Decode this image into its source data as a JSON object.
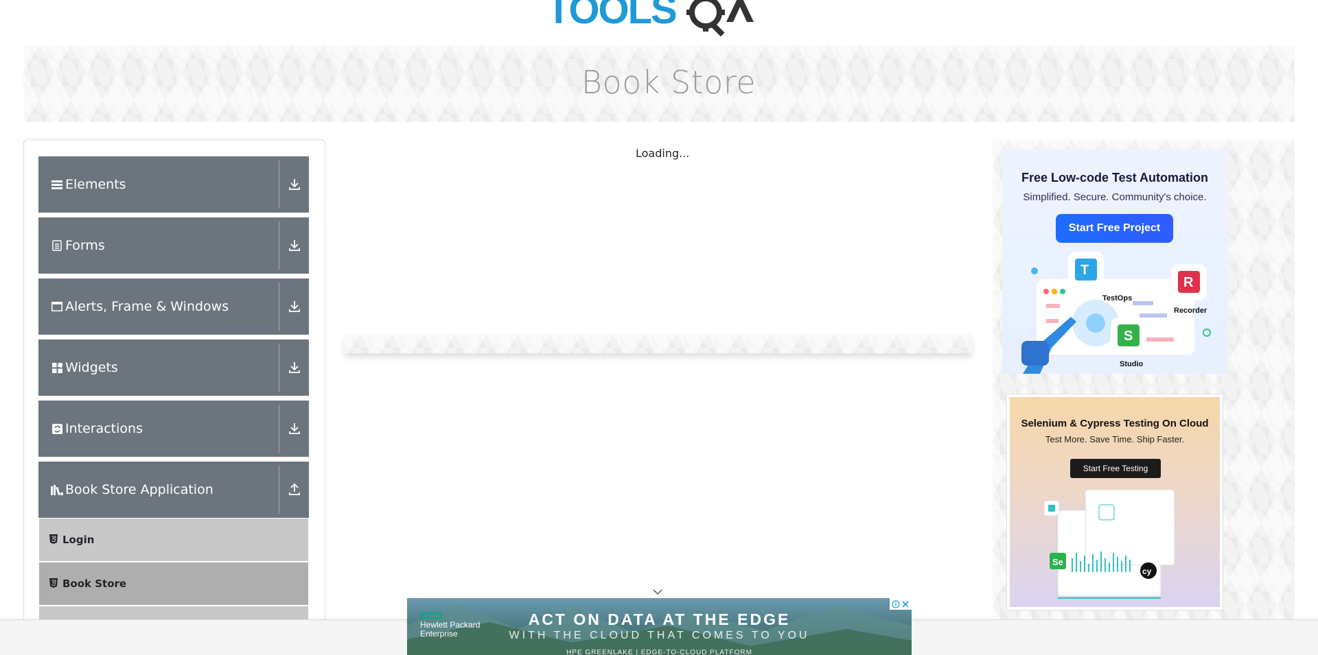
{
  "logo": {
    "text": "TOOLSQA",
    "colors": {
      "tools": "#1f9ad6",
      "qa": "#333333"
    }
  },
  "header": {
    "title": "Book Store"
  },
  "sidebar": {
    "groups": [
      {
        "label": "Elements",
        "icon": "hamburger-icon",
        "toggle": "download-icon"
      },
      {
        "label": "Forms",
        "icon": "form-icon",
        "toggle": "download-icon"
      },
      {
        "label": "Alerts, Frame & Windows",
        "icon": "window-icon",
        "toggle": "download-icon"
      },
      {
        "label": "Widgets",
        "icon": "widgets-icon",
        "toggle": "download-icon"
      },
      {
        "label": "Interactions",
        "icon": "interactions-icon",
        "toggle": "download-icon"
      },
      {
        "label": "Book Store Application",
        "icon": "books-icon",
        "toggle": "upload-icon"
      }
    ],
    "items": [
      {
        "label": "Login",
        "icon": "html5-icon"
      },
      {
        "label": "Book Store",
        "icon": "html5-icon"
      }
    ]
  },
  "main": {
    "loading_text": "Loading..."
  },
  "ads": {
    "ad1": {
      "title": "Free Low-code Test Automation",
      "subtitle": "Simplified. Secure. Community's choice.",
      "button": "Start Free Project",
      "labels": [
        "TestOps",
        "Recorder",
        "Studio"
      ]
    },
    "ad2": {
      "title": "Selenium & Cypress Testing On Cloud",
      "subtitle": "Test More. Save Time. Ship Faster.",
      "button": "Start Free Testing"
    },
    "bottom": {
      "brand_line1": "Hewlett Packard",
      "brand_line2": "Enterprise",
      "title": "ACT ON DATA AT THE EDGE",
      "subtitle": "WITH THE CLOUD THAT COMES TO YOU",
      "tagline": "HPE GREENLAKE | EDGE-TO-CLOUD PLATFORM"
    }
  },
  "colors": {
    "sidebar_group": "#6c757d",
    "menu_item": "#c8c8c8",
    "menu_item_active": "#aeaeae"
  }
}
